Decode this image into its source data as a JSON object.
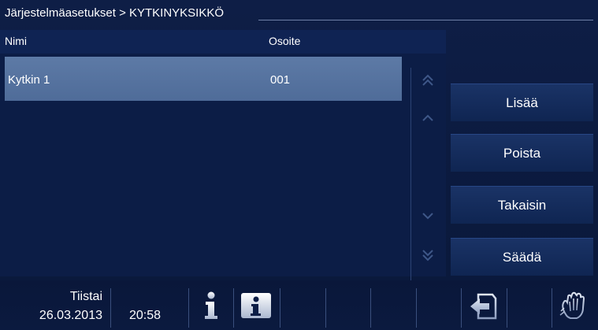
{
  "header": {
    "breadcrumb": "Järjestelmäasetukset > KYTKINYKSIKKÖ"
  },
  "list": {
    "columns": {
      "name": "Nimi",
      "address": "Osoite"
    },
    "rows": [
      {
        "name": "Kytkin 1",
        "address": "001"
      }
    ]
  },
  "scroll": {
    "icons": [
      "double-chevron-up-icon",
      "chevron-up-icon",
      "chevron-down-icon",
      "double-chevron-down-icon"
    ]
  },
  "actions": {
    "add": "Lisää",
    "remove": "Poista",
    "back": "Takaisin",
    "adjust": "Säädä"
  },
  "status": {
    "day": "Tiistai",
    "date": "26.03.2013",
    "time": "20:58"
  },
  "icons": {
    "info": "info-icon",
    "contact": "contact-info-icon",
    "return": "return-icon",
    "clean": "hand-wipe-icon"
  },
  "colors": {
    "background": "#0c1a3e",
    "selected_row": "#5a77a3",
    "button": "#142c5e",
    "text": "#ffffff"
  }
}
